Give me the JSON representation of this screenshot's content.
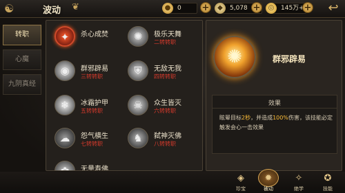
{
  "topbar": {
    "title": "波动",
    "currencies": [
      {
        "icon": "gold-ingot-icon",
        "value": "0"
      },
      {
        "icon": "silver-icon",
        "value": "5,078"
      },
      {
        "icon": "coin-icon",
        "value": "145万+"
      }
    ]
  },
  "left_tabs": [
    {
      "label": "转职",
      "active": true
    },
    {
      "label": "心魔",
      "active": false
    },
    {
      "label": "九阴真经",
      "active": false
    }
  ],
  "skills": [
    {
      "name": "杀心成焚",
      "req": "",
      "icon": "flame-icon",
      "selected": true
    },
    {
      "name": "极乐天舞",
      "req": "二转转职",
      "icon": "dance-icon",
      "selected": false
    },
    {
      "name": "群邪辟易",
      "req": "三转转职",
      "icon": "swirl-icon",
      "selected": false
    },
    {
      "name": "无敌无我",
      "req": "四转转职",
      "icon": "shield-icon",
      "selected": false
    },
    {
      "name": "冰霜护甲",
      "req": "五转转职",
      "icon": "frost-icon",
      "selected": false
    },
    {
      "name": "众生皆灭",
      "req": "六转转职",
      "icon": "skull-icon",
      "selected": false
    },
    {
      "name": "怨气横生",
      "req": "七转转职",
      "icon": "ghost-icon",
      "selected": false
    },
    {
      "name": "弑神灭佛",
      "req": "八转转职",
      "icon": "figure-icon",
      "selected": false
    },
    {
      "name": "无量寿佛",
      "req": "",
      "icon": "lotus-icon",
      "selected": false
    }
  ],
  "detail": {
    "skill_name": "群邪辟易",
    "effect_title": "效果",
    "effect_pre": "眩晕目标",
    "effect_num1": "2秒",
    "effect_mid": "，并造成",
    "effect_num2": "100%",
    "effect_post": "伤害，该技能必定触发会心一击效果"
  },
  "bottom_nav": [
    {
      "label": "珍宝",
      "icon": "treasure-icon",
      "active": false
    },
    {
      "label": "被动",
      "icon": "passive-icon",
      "active": true
    },
    {
      "label": "绝学",
      "icon": "book-icon",
      "active": false
    },
    {
      "label": "技能",
      "icon": "skill-icon",
      "active": false
    }
  ]
}
